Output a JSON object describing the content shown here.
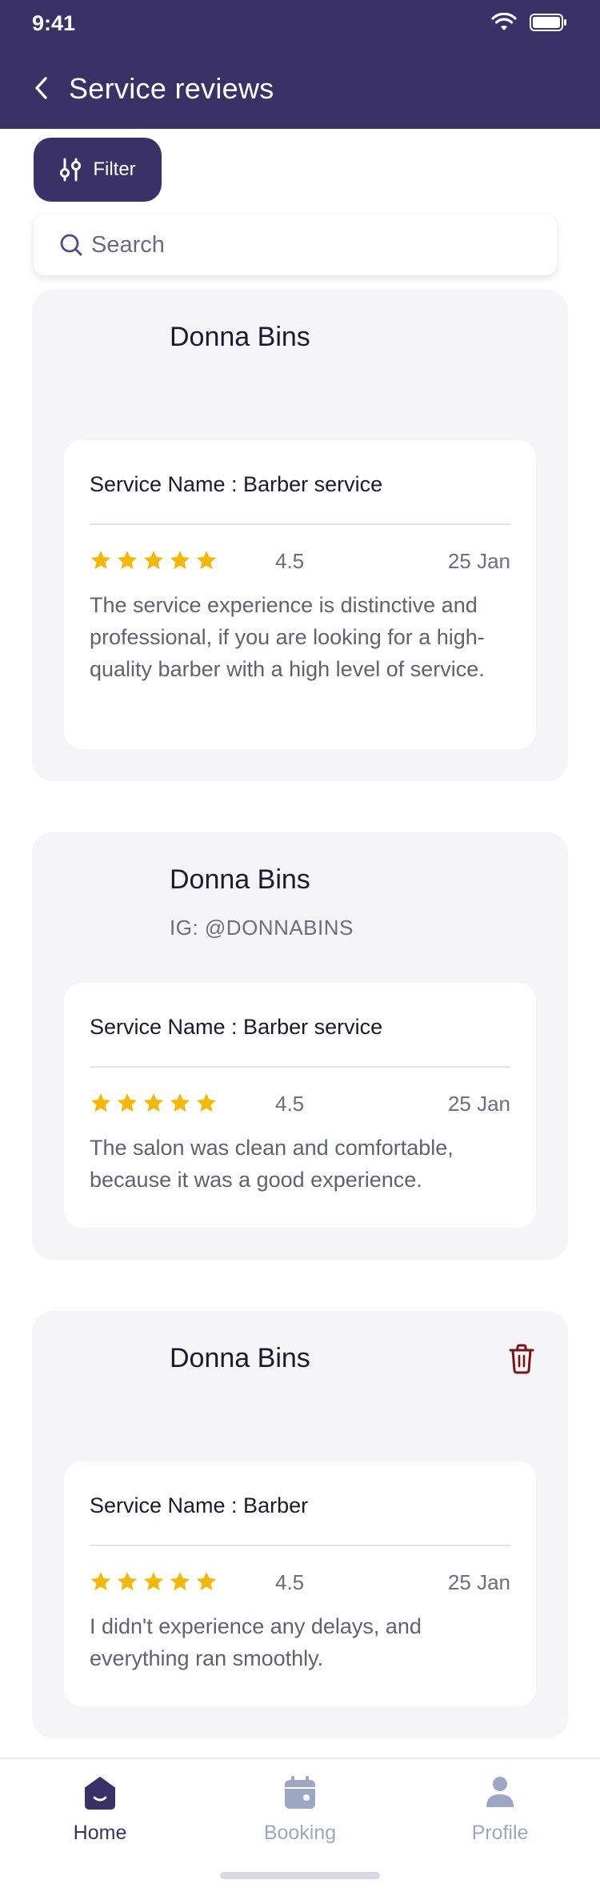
{
  "status_bar": {
    "time": "9:41"
  },
  "header": {
    "title": "Service reviews"
  },
  "filter": {
    "label": "Filter"
  },
  "search": {
    "placeholder": "Search"
  },
  "reviews": [
    {
      "name": "Donna Bins",
      "handle": "",
      "service": "Service Name : Barber service",
      "rating": "4.5",
      "stars": 5,
      "date": "25 Jan",
      "comment": "The service experience is distinctive and professional, if you are looking for a high-quality barber with a high level of service."
    },
    {
      "name": "Donna Bins",
      "handle": "IG: @DONNABINS",
      "service": "Service Name : Barber service",
      "rating": "4.5",
      "stars": 5,
      "date": "25 Jan",
      "comment": "The salon was clean and comfortable, because it was a good experience."
    },
    {
      "name": "Donna Bins",
      "handle": "",
      "service": "Service Name : Barber",
      "rating": "4.5",
      "stars": 5,
      "date": "25 Jan",
      "comment": "I didn't experience any delays, and everything ran smoothly."
    }
  ],
  "nav": {
    "items": [
      {
        "label": "Home",
        "active": true
      },
      {
        "label": "Booking",
        "active": false
      },
      {
        "label": "Profile",
        "active": false
      }
    ]
  },
  "colors": {
    "primary": "#3a3166",
    "star": "#f5b800",
    "delete": "#7a1414",
    "nav_inactive": "#9ca7c4"
  }
}
